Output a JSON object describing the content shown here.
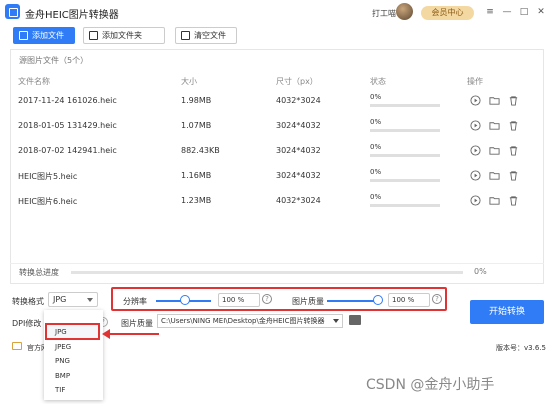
{
  "app": {
    "title": "金舟HEIC图片转换器",
    "assistant": "打工喵",
    "vip": "会员中心",
    "minimize": "—",
    "restore": "□",
    "close": "✕",
    "menu": "≡"
  },
  "toolbar": {
    "add_file": "添加文件",
    "add_folder": "添加文件夹",
    "clear": "清空文件"
  },
  "panel": {
    "source_label": "源图片文件（5个）"
  },
  "table": {
    "headers": [
      "文件名称",
      "大小",
      "尺寸（px）",
      "状态",
      "操作"
    ],
    "rows": [
      {
        "name": "2017-11-24 161026.heic",
        "size": "1.98MB",
        "dims": "4032*3024",
        "status": "0%",
        "progress": 0
      },
      {
        "name": "2018-01-05 131429.heic",
        "size": "1.07MB",
        "dims": "3024*4032",
        "status": "0%",
        "progress": 0
      },
      {
        "name": "2018-07-02 142941.heic",
        "size": "882.43KB",
        "dims": "3024*4032",
        "status": "0%",
        "progress": 0
      },
      {
        "name": "HEIC图片5.heic",
        "size": "1.16MB",
        "dims": "3024*4032",
        "status": "0%",
        "progress": 0
      },
      {
        "name": "HEIC图片6.heic",
        "size": "1.23MB",
        "dims": "4032*3024",
        "status": "0%",
        "progress": 0
      }
    ]
  },
  "progress": {
    "label": "转换总进度",
    "value": "0%"
  },
  "settings": {
    "format_label": "转换格式",
    "format_value": "JPG",
    "resolution_label": "分辨率",
    "resolution_value": "100 %",
    "quality_label": "图片质量",
    "quality_value": "100 %",
    "dpi_label": "DPI修改",
    "output_label": "图片质量",
    "output_path": "C:\\Users\\NING MEI\\Desktop\\金舟HEIC图片转换器",
    "help": "?",
    "start": "开始转换"
  },
  "dropdown": {
    "options": [
      "JPG",
      "JPEG",
      "PNG",
      "BMP",
      "TIF"
    ]
  },
  "footer": {
    "official": "官方网",
    "version": "版本号：v3.6.5"
  },
  "watermark": "CSDN @金舟小助手",
  "colors": {
    "accent": "#2f7cf6",
    "highlight": "#e03434"
  }
}
